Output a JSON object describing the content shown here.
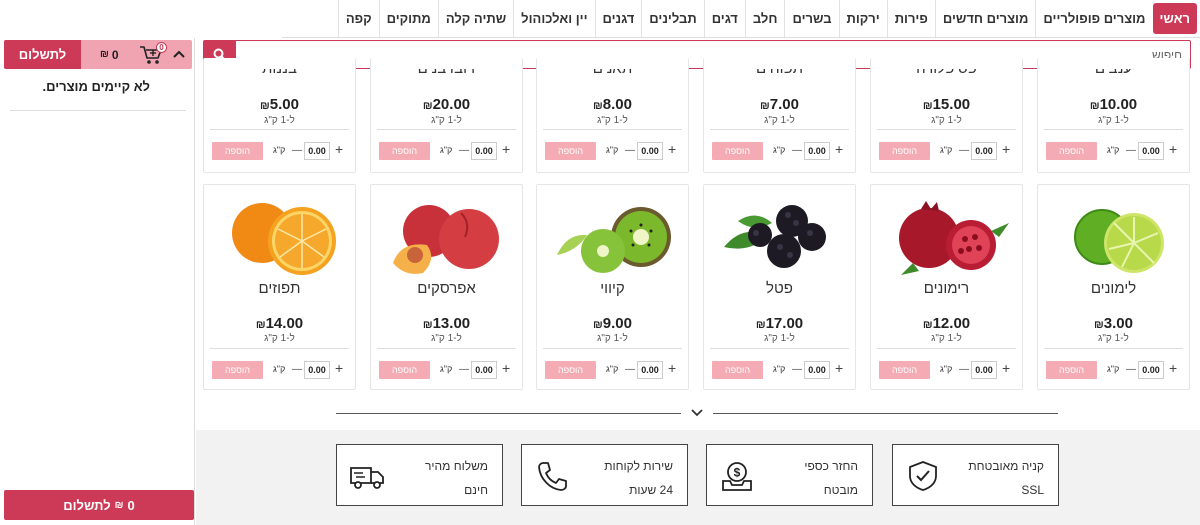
{
  "nav": {
    "tabs": [
      "ראשי",
      "מוצרים פופולריים",
      "מוצרים חדשים",
      "פירות",
      "ירקות",
      "בשרים",
      "חלב",
      "דגים",
      "תבלינים",
      "דגנים",
      "יין ואלכוהול",
      "שתיה קלה",
      "מתוקים",
      "קפה"
    ],
    "active_tab": "ראשי"
  },
  "search": {
    "placeholder": "חיפוש",
    "icon": "search-icon"
  },
  "cart": {
    "pay_label": "לתשלום",
    "total": "0",
    "currency": "₪",
    "item_count": "0",
    "empty_message": "לא קיימים מוצרים.",
    "bottom_total": "0",
    "bottom_label": "לתשלום"
  },
  "product_controls": {
    "add_label": "הוספה",
    "unit_short": "ק\"ג",
    "qty_value": "0.00",
    "per_unit": "ל-1 ק\"ג",
    "currency": "₪"
  },
  "products_row1": [
    {
      "name": "ענבים",
      "price": "10.00"
    },
    {
      "name": "פסיפלורה",
      "price": "15.00"
    },
    {
      "name": "תפוחים",
      "price": "7.00"
    },
    {
      "name": "תאנים",
      "price": "8.00"
    },
    {
      "name": "דובדבנים",
      "price": "20.00"
    },
    {
      "name": "בננות",
      "price": "5.00"
    }
  ],
  "products_row2": [
    {
      "name": "לימונים",
      "price": "3.00",
      "image": "lime"
    },
    {
      "name": "רימונים",
      "price": "12.00",
      "image": "pomegranate"
    },
    {
      "name": "פטל",
      "price": "17.00",
      "image": "blackberry"
    },
    {
      "name": "קיווי",
      "price": "9.00",
      "image": "kiwi"
    },
    {
      "name": "אפרסקים",
      "price": "13.00",
      "image": "peach"
    },
    {
      "name": "תפוזים",
      "price": "14.00",
      "image": "orange"
    }
  ],
  "features": [
    {
      "line1": "קניה מאובטחת",
      "line2": "SSL",
      "icon": "shield-check-icon"
    },
    {
      "line1": "החזר כספי",
      "line2": "מובטח",
      "icon": "money-back-icon"
    },
    {
      "line1": "שירות לקוחות",
      "line2": "24 שעות",
      "icon": "phone-icon"
    },
    {
      "line1": "משלוח מהיר",
      "line2": "חינם",
      "icon": "delivery-truck-icon"
    }
  ],
  "colors": {
    "accent": "#cc3a57",
    "accent_light": "#f4abb4"
  }
}
